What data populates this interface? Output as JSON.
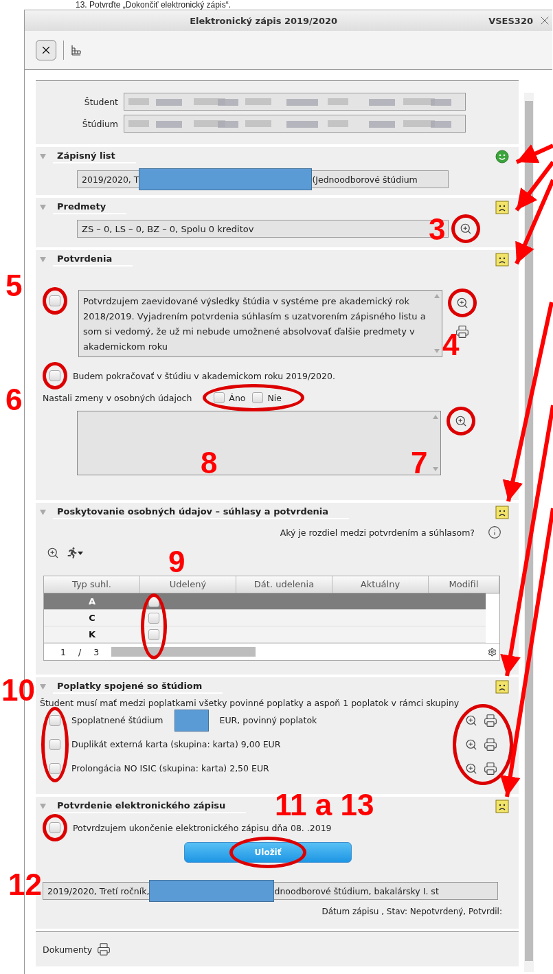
{
  "instruction": "13. Potvrďte „Dokončiť elektronický zápis“.",
  "window": {
    "title": "Elektronický zápis 2019/2020",
    "user": "VSES320"
  },
  "student": [
    {
      "label": "Študent"
    },
    {
      "label": "Štúdium"
    }
  ],
  "enrollment_sheet": {
    "title": "Zápisný list",
    "satisfied": true,
    "value_start": "2019/2020, T",
    "value_end": "(Jednoodborové štúdium"
  },
  "courses": {
    "title": "Predmety",
    "satisfied": false,
    "value": "ZS – 0, LS – 0, BZ – 0, Spolu 0 kreditov"
  },
  "confirmations": {
    "title": "Potvrdenia",
    "satisfied": false,
    "statement": {
      "checked": false,
      "text": "Potvrdzujem zaevidované výsledky štúdia v systéme pre akademický rok 2018/2019. Vyjadrením potvrdenia súhlasím s uzatvorením zápisného listu a som si vedomý, že už mi nebude umožnené absolvovať ďalšie predmety v akademickom roku"
    },
    "continue": {
      "checked": false,
      "label": "Budem pokračovať v štúdiu v akademickom roku 2019/2020."
    },
    "changes": {
      "label": "Nastali zmeny v osobných údajoch",
      "options": [
        {
          "label": "Áno",
          "checked": false
        },
        {
          "label": "Nie",
          "checked": false
        }
      ]
    }
  },
  "personal_data": {
    "title": "Poskytovanie osobných údajov – súhlasy a potvrdenia",
    "satisfied": false,
    "question": "Aký je rozdiel medzi potvrdením a súhlasom?",
    "columns": [
      "Typ suhl.",
      "Udelený",
      "Dát. udelenia",
      "Aktuálny",
      "Modifil"
    ],
    "rows": [
      {
        "type": "A",
        "selected": true,
        "granted": false
      },
      {
        "type": "C",
        "selected": false,
        "granted": false
      },
      {
        "type": "K",
        "selected": false,
        "granted": false
      }
    ],
    "pager": {
      "page": "1",
      "separator": "/",
      "total": "3"
    }
  },
  "fees": {
    "title": "Poplatky spojené so štúdiom",
    "satisfied": false,
    "note": "Študent musí mať medzi poplatkami všetky povinné poplatky a aspoň 1 poplatok v rámci skupiny",
    "items": [
      {
        "checked": false,
        "text": "Spoplatnené štúdium",
        "text_end": "EUR, povinný poplatok"
      },
      {
        "checked": false,
        "text": "Duplikát externá karta (skupina: karta) 9,00 EUR"
      },
      {
        "checked": false,
        "text": "Prolongácia NO ISIC (skupina: karta) 2,50 EUR"
      }
    ]
  },
  "completion": {
    "title": "Potvrdenie elektronického zápisu",
    "satisfied": false,
    "confirm": {
      "checked": false,
      "label": "Potvrdzujem ukončenie elektronického zápisu dňa 08. .2019"
    },
    "save_button": "Uložiť",
    "value_start": "2019/2020, Tretí ročník,",
    "value_end": "dnoodborové štúdium, bakalársky I. st",
    "status_line": "Dátum zápisu , Stav: Nepotvrdený, Potvrdil:"
  },
  "documents": {
    "label": "Dokumenty"
  },
  "annotations": [
    "3",
    "4",
    "5",
    "6",
    "7",
    "8",
    "9",
    "10",
    "11 a 13",
    "12"
  ]
}
